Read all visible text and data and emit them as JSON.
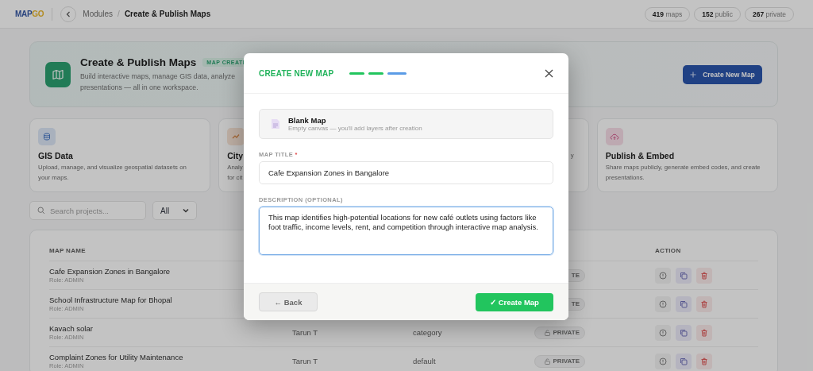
{
  "header": {
    "logo": {
      "primary": "MAP",
      "accent": "GO"
    },
    "breadcrumb_separator": "/",
    "breadcrumb": [
      {
        "label": "Modules",
        "current": false
      },
      {
        "label": "Create & Publish Maps",
        "current": true
      }
    ],
    "stats": [
      {
        "value": "419",
        "label": "maps"
      },
      {
        "value": "152",
        "label": "public"
      },
      {
        "value": "267",
        "label": "private"
      }
    ]
  },
  "hero": {
    "title": "Create & Publish Maps",
    "badge": "MAP CREATI",
    "description": [
      "Build interactive maps, manage GIS data, analyze",
      "presentations — all in one workspace."
    ],
    "button": "Create New Map"
  },
  "features": [
    {
      "kind": "data",
      "title": "GIS Data",
      "description": [
        "Upload, manage, and visualize geospatial datasets on",
        "your maps."
      ]
    },
    {
      "kind": "analytics",
      "title": "City",
      "description": [
        "Analy",
        "for cit"
      ]
    },
    {
      "kind": "covered",
      "description": [
        "y"
      ]
    },
    {
      "kind": "publish",
      "title": "Publish & Embed",
      "description": [
        "Share maps publicly, generate embed codes, and create",
        "presentations."
      ]
    }
  ],
  "filters": {
    "search": {
      "placeholder": "Search projects..."
    },
    "select": {
      "value": "All"
    }
  },
  "table": {
    "columns": {
      "name": "MAP NAME",
      "action": "ACTION"
    },
    "rows": [
      {
        "name": "Cafe Expansion Zones in Bangalore",
        "role": "Role: ADMIN",
        "status": "TE"
      },
      {
        "name": "School Infrastructure Map for Bhopal",
        "role": "Role: ADMIN",
        "status": "TE"
      },
      {
        "name": "Kavach solar",
        "role": "Role: ADMIN",
        "owner": "Tarun T",
        "category": "category",
        "status": "PRIVATE",
        "lock_visible": true
      },
      {
        "name": "Complaint Zones for Utility Maintenance",
        "role": "Role: ADMIN",
        "owner": "Tarun T",
        "category": "default",
        "status": "PRIVATE",
        "lock_visible": true
      }
    ]
  },
  "modal": {
    "title": "CREATE NEW MAP",
    "steps": [
      {
        "color": "#22c55e"
      },
      {
        "color": "#22c55e"
      },
      {
        "color": "#5b9ce6"
      }
    ],
    "template": {
      "title": "Blank Map",
      "subtitle": "Empty canvas — you'll add layers after creation"
    },
    "title_field": {
      "label": "MAP TITLE",
      "required_mark": "*",
      "value": "Cafe Expansion Zones in Bangalore",
      "focused": false
    },
    "description_field": {
      "label": "DESCRIPTION (OPTIONAL)",
      "value": "This map identifies high-potential locations for new café outlets using factors like foot traffic, income levels, rent, and competition through interactive map analysis.",
      "focused": true
    },
    "back_button": "← Back",
    "create_button": "✓ Create Map"
  }
}
